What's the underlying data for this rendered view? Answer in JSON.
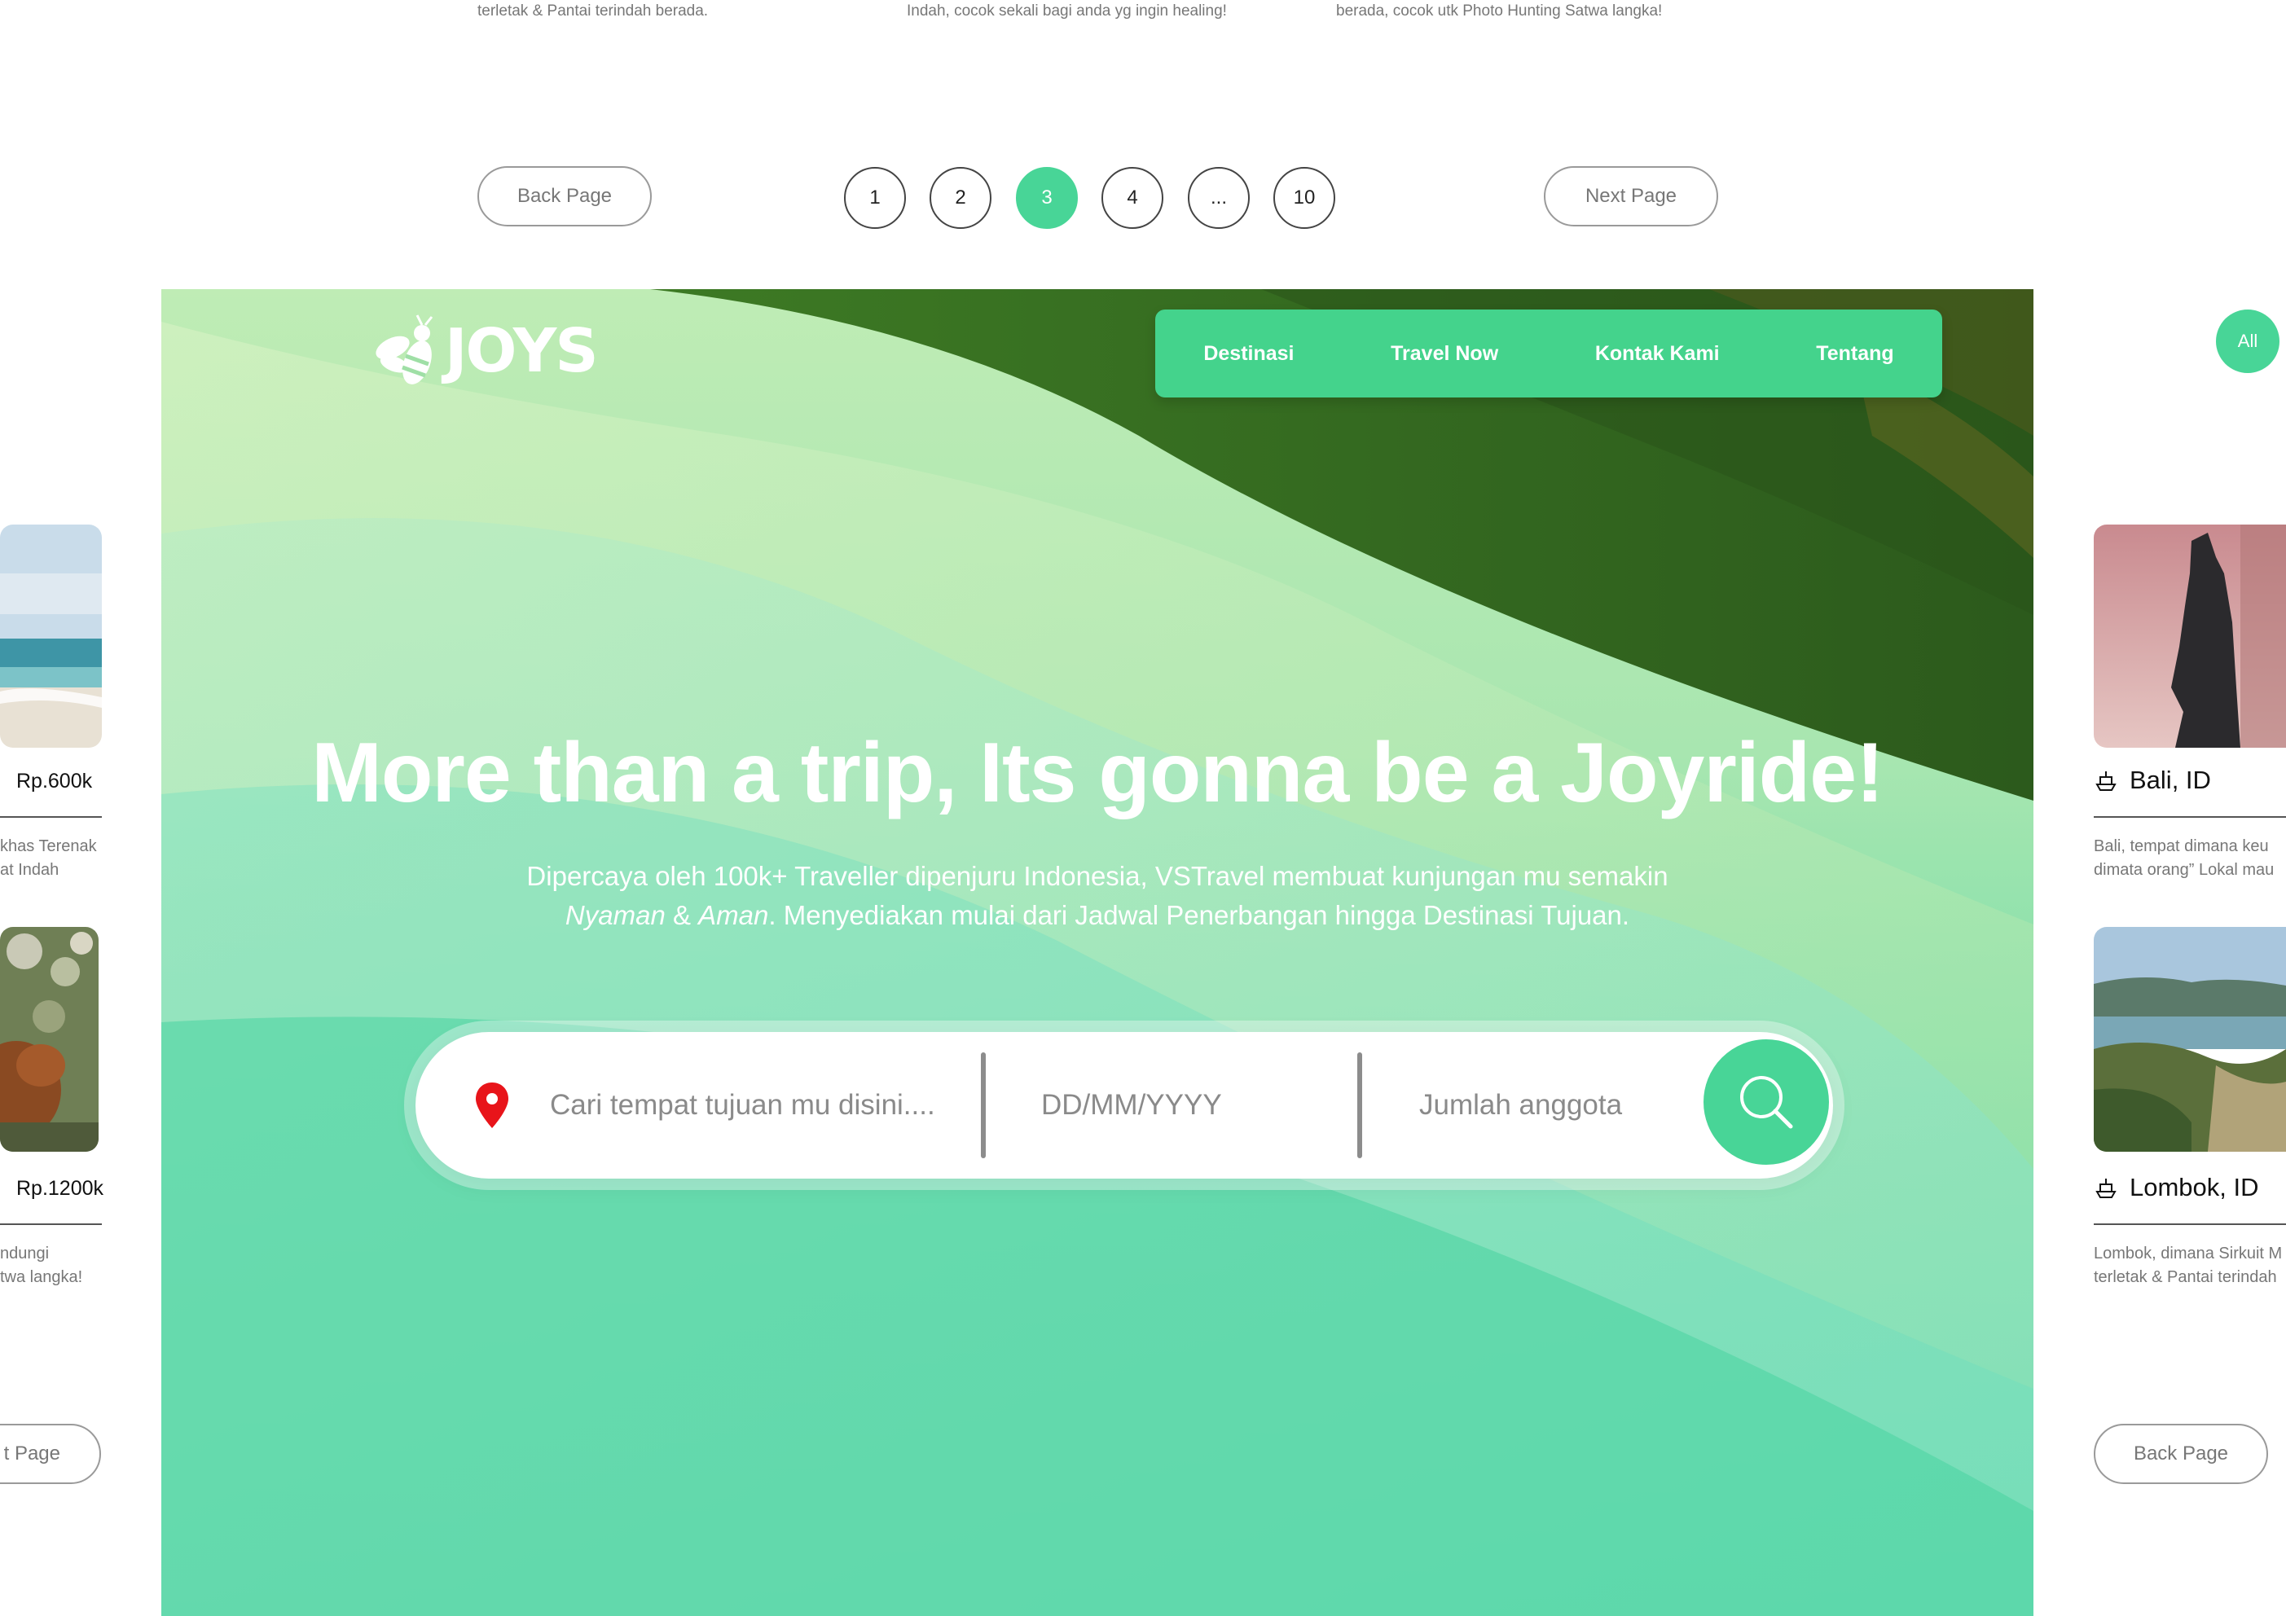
{
  "top_strip": {
    "desc_1": "terletak & Pantai terindah berada.",
    "desc_2": "Indah, cocok sekali bagi anda yg ingin healing!",
    "desc_3": "berada, cocok utk Photo Hunting Satwa langka!"
  },
  "pagination": {
    "back_label": "Back Page",
    "next_label": "Next Page",
    "pages": [
      "1",
      "2",
      "3",
      "4",
      "...",
      "10"
    ],
    "active_page": "3"
  },
  "hero": {
    "logo_text": "JOYS",
    "nav": [
      "Destinasi",
      "Travel Now",
      "Kontak Kami",
      "Tentang"
    ],
    "headline": "More than a trip, Its gonna be a Joyride!",
    "subtitle_line1": "Dipercaya oleh 100k+ Traveller dipenjuru Indonesia,  VSTravel membuat kunjungan mu semakin",
    "subtitle_italic1": "Nyaman",
    "subtitle_amp": " & ",
    "subtitle_italic2": "Aman",
    "subtitle_rest": ". Menyediakan mulai dari Jadwal Penerbangan hingga Destinasi Tujuan.",
    "search": {
      "destination_placeholder": "Cari tempat tujuan mu disini....",
      "date_placeholder": "DD/MM/YYYY",
      "members_placeholder": "Jumlah anggota"
    }
  },
  "left_column": {
    "price_1": "Rp.600k",
    "desc_1a": "khas Terenak",
    "desc_1b": "at Indah",
    "price_2": "Rp.1200k",
    "desc_2a": "ndungi",
    "desc_2b": "twa langka!",
    "next_label": "t Page"
  },
  "right_column": {
    "all_label": "All",
    "place_1": "Bali, ID",
    "desc_1a": "Bali, tempat dimana keu",
    "desc_1b": "dimata orang” Lokal mau",
    "place_2": "Lombok, ID",
    "desc_2a": "Lombok, dimana Sirkuit M",
    "desc_2b": "terletak & Pantai terindah",
    "back_label": "Back Page"
  },
  "colors": {
    "accent": "#48d597",
    "nav_bg": "#44d38c",
    "pin": "#e8141a"
  }
}
